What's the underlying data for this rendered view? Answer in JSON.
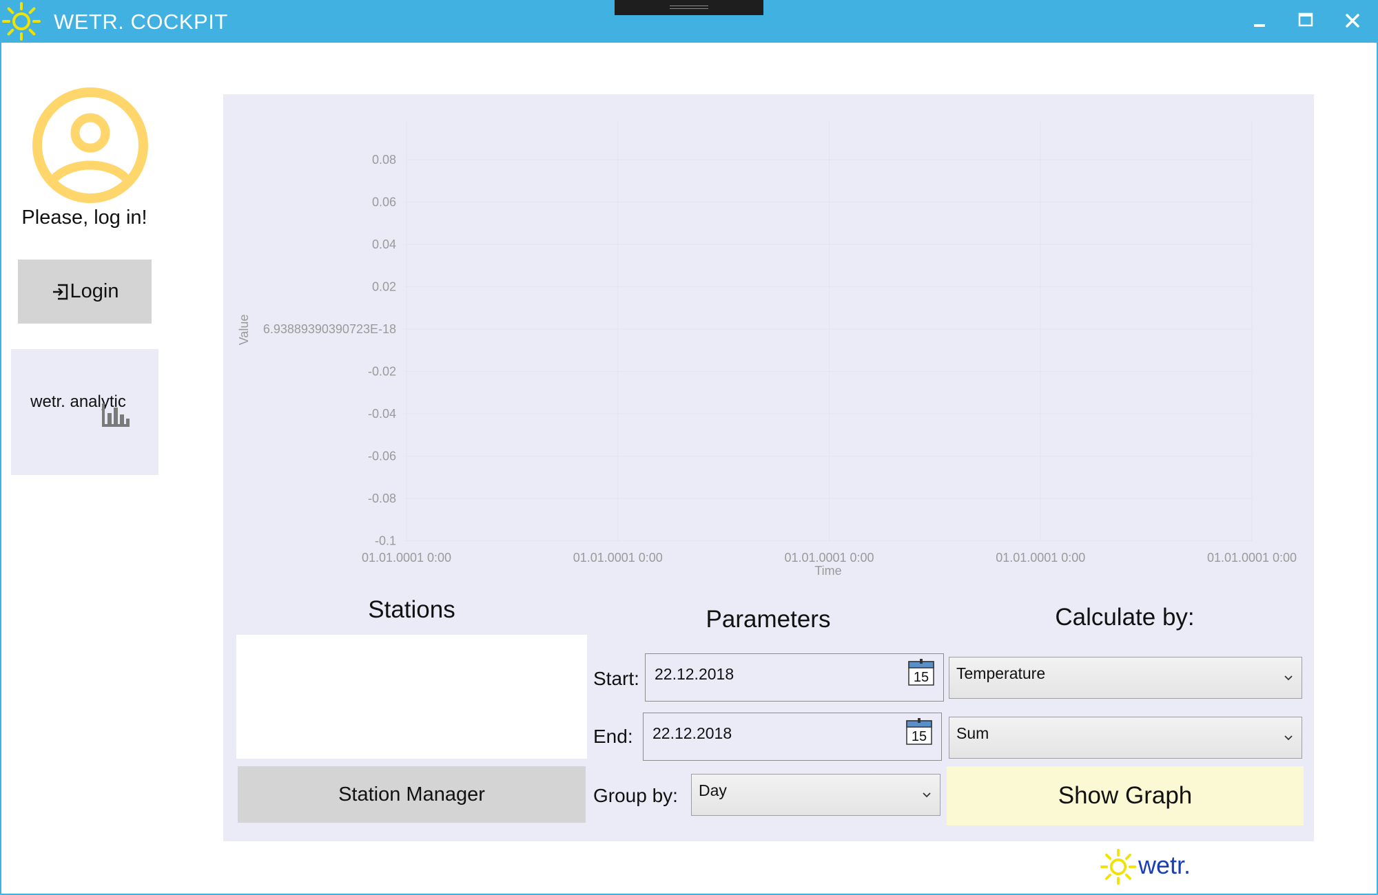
{
  "window": {
    "title": "WETR. COCKPIT",
    "controls": [
      "minimize",
      "maximize",
      "close"
    ]
  },
  "sidebar": {
    "login_prompt": "Please, log in!",
    "login_button": "Login",
    "analytic_tile": "wetr. analytic"
  },
  "chart_data": {
    "type": "line",
    "series": [],
    "xlabel": "Time",
    "ylabel": "Value",
    "y_ticks": [
      "0.08",
      "0.06",
      "0.04",
      "0.02",
      "6.93889390390723E-18",
      "-0.02",
      "-0.04",
      "-0.06",
      "-0.08",
      "-0.1"
    ],
    "x_ticks": [
      "01.01.0001 0:00",
      "01.01.0001 0:00",
      "01.01.0001 0:00",
      "01.01.0001 0:00",
      "01.01.0001 0:00"
    ],
    "ylim": [
      -0.1,
      0.1
    ],
    "grid": true
  },
  "stations": {
    "title": "Stations",
    "items": [],
    "manager_button": "Station Manager"
  },
  "parameters": {
    "title": "Parameters",
    "start_label": "Start:",
    "start_value": "22.12.2018",
    "end_label": "End:",
    "end_value": "22.12.2018",
    "calendar_day": "15",
    "group_label": "Group by:",
    "group_value": "Day"
  },
  "calculate": {
    "title": "Calculate by:",
    "parameter_value": "Temperature",
    "aggregation_value": "Sum",
    "show_button": "Show Graph"
  },
  "brand": {
    "text": "wetr."
  },
  "colors": {
    "titlebar": "#41b1e1",
    "panel": "#ebeaf7",
    "avatar": "#ffd66b",
    "sun": "#f2e200",
    "show_button": "#fbf9d3",
    "brand_text": "#1a3fb5"
  }
}
